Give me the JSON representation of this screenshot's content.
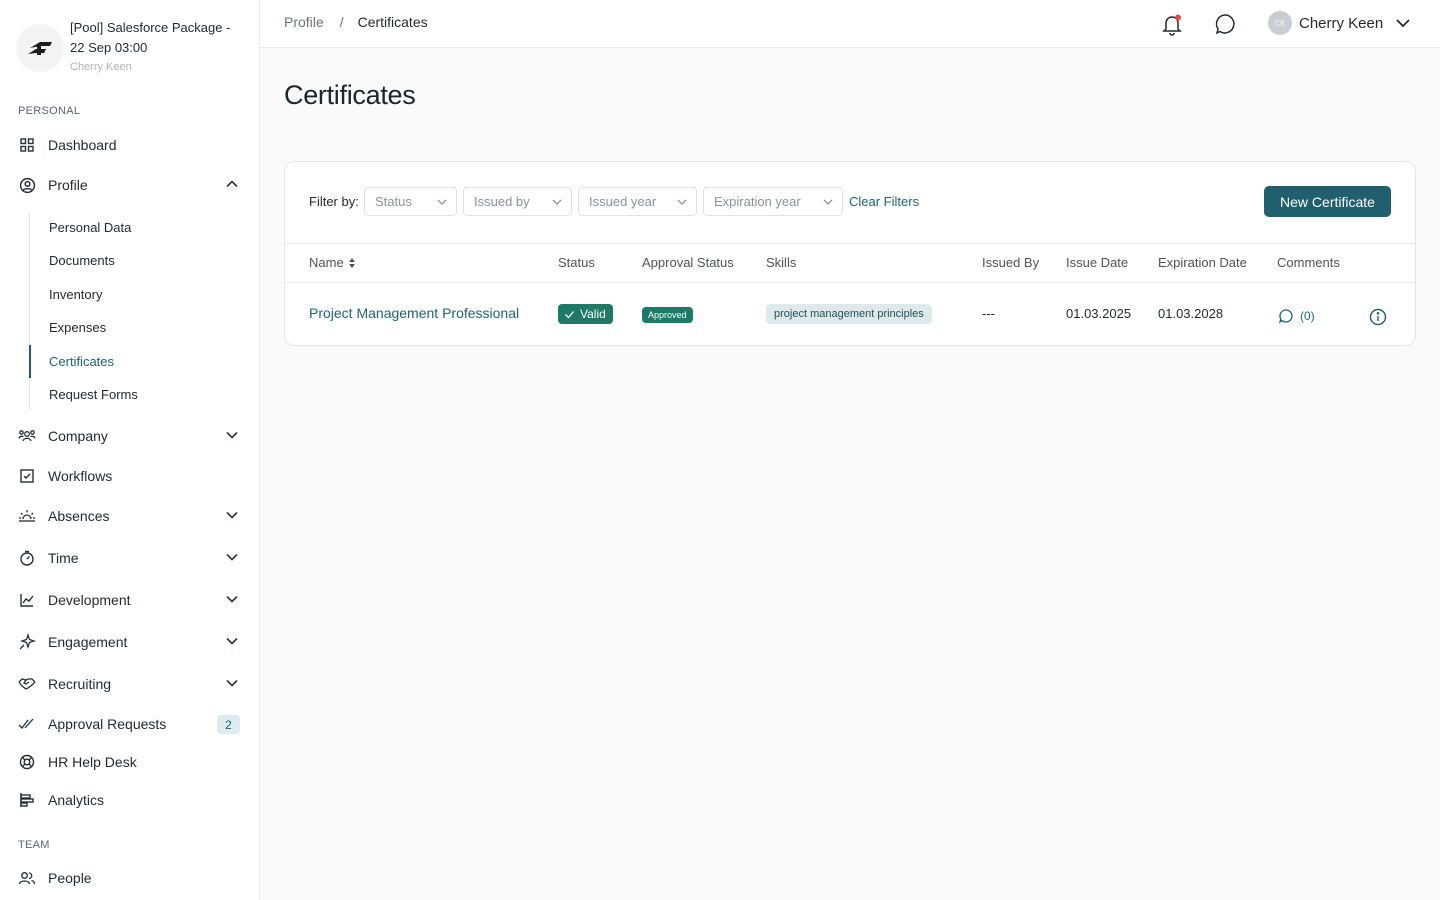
{
  "company": {
    "name": "[Pool] Salesforce Package - 22 Sep 03:00",
    "user": "Cherry Keen"
  },
  "sidebar": {
    "personal_label": "PERSONAL",
    "team_label": "TEAM",
    "items": [
      {
        "label": "Dashboard",
        "icon": "grid-icon"
      },
      {
        "label": "Profile",
        "icon": "user-circle-icon"
      },
      {
        "label": "Company",
        "icon": "users-icon"
      },
      {
        "label": "Workflows",
        "icon": "checkbox-icon"
      },
      {
        "label": "Absences",
        "icon": "sunrise-icon"
      },
      {
        "label": "Time",
        "icon": "stopwatch-icon"
      },
      {
        "label": "Development",
        "icon": "chart-line-icon"
      },
      {
        "label": "Engagement",
        "icon": "sparkle-icon"
      },
      {
        "label": "Recruiting",
        "icon": "handshake-icon"
      },
      {
        "label": "Approval Requests",
        "icon": "double-check-icon",
        "badge": "2"
      },
      {
        "label": "HR Help Desk",
        "icon": "lifebuoy-icon"
      },
      {
        "label": "Analytics",
        "icon": "bar-chart-icon"
      }
    ],
    "team_items": [
      {
        "label": "People",
        "icon": "people-icon"
      }
    ],
    "profile_sub": [
      {
        "label": "Personal Data"
      },
      {
        "label": "Documents"
      },
      {
        "label": "Inventory"
      },
      {
        "label": "Expenses"
      },
      {
        "label": "Certificates"
      },
      {
        "label": "Request Forms"
      }
    ]
  },
  "header": {
    "breadcrumb": [
      "Profile",
      "Certificates"
    ],
    "separator": "/",
    "user_initials": "CK",
    "user_name": "Cherry Keen",
    "notification_dot_color": "#e5484d"
  },
  "page": {
    "title": "Certificates"
  },
  "filters": {
    "label": "Filter by:",
    "selects": [
      "Status",
      "Issued by",
      "Issued year",
      "Expiration year"
    ],
    "clear": "Clear Filters",
    "new_button": "New Certificate"
  },
  "table": {
    "columns": [
      "Name",
      "Status",
      "Approval Status",
      "Skills",
      "Issued By",
      "Issue Date",
      "Expiration Date",
      "Comments"
    ],
    "rows": [
      {
        "name": "Project Management Professional",
        "status": "Valid",
        "approval_status": "Approved",
        "skills": "project management principles",
        "issued_by": "---",
        "issue_date": "01.03.2025",
        "expiration_date": "01.03.2028",
        "comments": "(0)"
      }
    ]
  },
  "colors": {
    "accent": "#1f5f6e",
    "status_green": "#1e7a66"
  }
}
